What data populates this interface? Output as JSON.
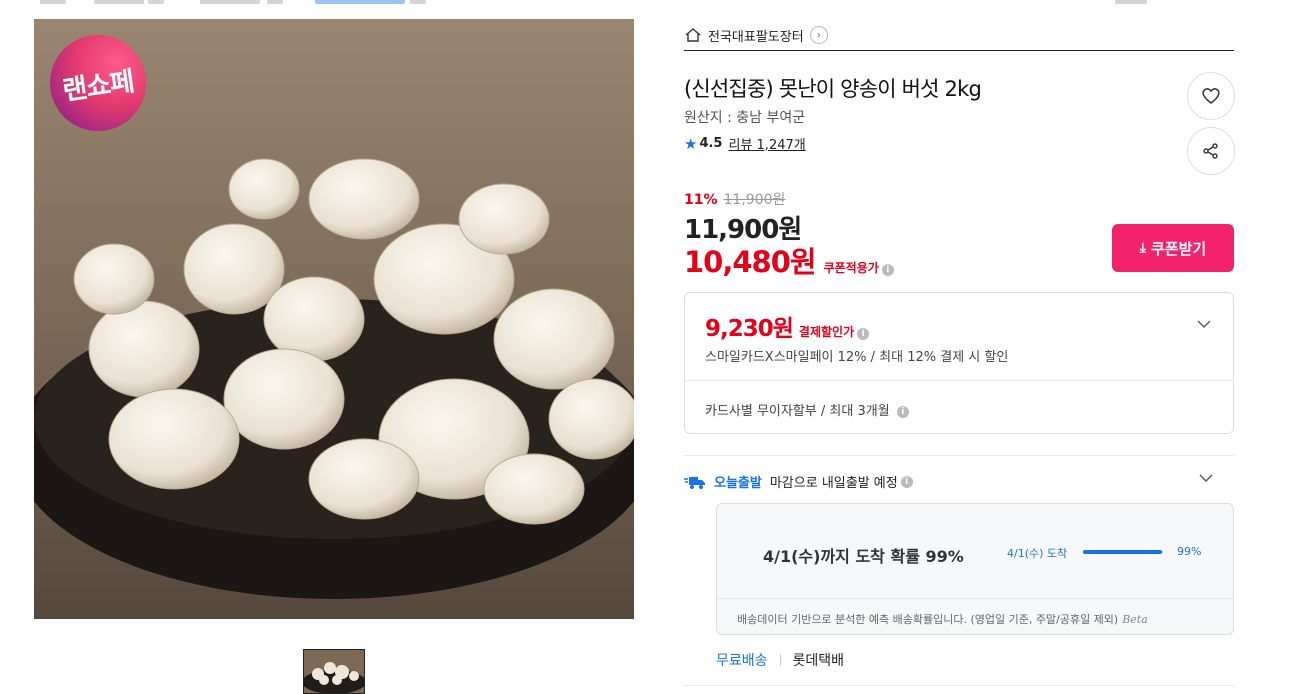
{
  "store": {
    "name": "전국대표팔도장터"
  },
  "product": {
    "title": "(신선집중) 못난이 양송이 버섯 2kg",
    "origin": "원산지 : 충남 부여군",
    "rating": "4.5",
    "reviews": "리뷰 1,247개",
    "badge_text": "랜쇼페"
  },
  "price": {
    "discount_pct": "11%",
    "original": "11,900원",
    "sale": "11,900원",
    "coupon_price": "10,480원",
    "coupon_label": "쿠폰적용가",
    "coupon_button": "쿠폰받기"
  },
  "benefits": {
    "pay_price": "9,230원",
    "pay_label": "결제할인가",
    "pay_desc": "스마일카드X스마일페이 12% / 최대 12% 결제 시 할인",
    "installment": "카드사별 무이자할부 / 최대 3개월"
  },
  "shipping": {
    "today_label": "오늘출발",
    "today_text": "마감으로 내일출발 예정",
    "predict_head": "4/1(수)까지 도착 확률 99%",
    "bar_label": "4/1(수) 도착",
    "bar_pct": "99%",
    "bar_value": 0.99,
    "note": "배송데이터 기반으로 분석한 예측 배송확률입니다. (영업일 기준, 주말/공휴일 제외)",
    "beta": "Beta",
    "free_label": "무료배송",
    "carrier": "롯데택배"
  },
  "colors": {
    "accent_red": "#e5001a",
    "coupon_pink": "#f2236b",
    "link_blue": "#1a73e8"
  },
  "icons": [
    "home-icon",
    "chevron-right-icon",
    "heart-icon",
    "share-icon",
    "star-icon",
    "download-icon",
    "info-icon",
    "chevron-down-icon",
    "truck-icon"
  ]
}
